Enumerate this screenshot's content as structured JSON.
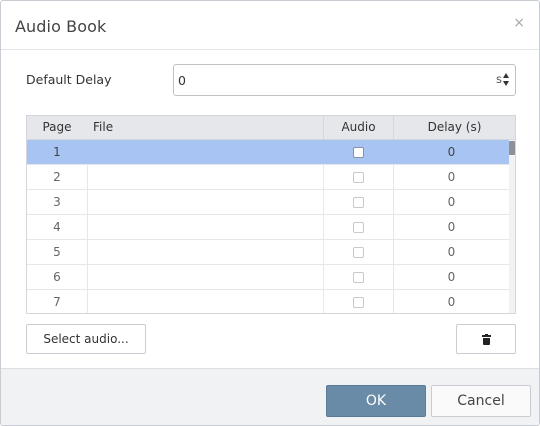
{
  "dialog": {
    "title": "Audio Book",
    "close_glyph": "×"
  },
  "default_delay": {
    "label": "Default Delay",
    "value": "0",
    "unit": "s"
  },
  "grid": {
    "columns": [
      "Page",
      "File",
      "Audio",
      "Delay (s)"
    ],
    "rows": [
      {
        "page": "1",
        "file": "",
        "audio": false,
        "delay": "0",
        "selected": true
      },
      {
        "page": "2",
        "file": "",
        "audio": false,
        "delay": "0",
        "selected": false
      },
      {
        "page": "3",
        "file": "",
        "audio": false,
        "delay": "0",
        "selected": false
      },
      {
        "page": "4",
        "file": "",
        "audio": false,
        "delay": "0",
        "selected": false
      },
      {
        "page": "5",
        "file": "",
        "audio": false,
        "delay": "0",
        "selected": false
      },
      {
        "page": "6",
        "file": "",
        "audio": false,
        "delay": "0",
        "selected": false
      },
      {
        "page": "7",
        "file": "",
        "audio": false,
        "delay": "0",
        "selected": false
      }
    ]
  },
  "actions": {
    "select_audio_label": "Select audio...",
    "delete_icon": "trash-icon"
  },
  "footer": {
    "ok_label": "OK",
    "cancel_label": "Cancel"
  },
  "colors": {
    "selected_row": "#a8c4f3",
    "ok_button": "#6a8ba8",
    "header_bg": "#e6e7ea"
  }
}
